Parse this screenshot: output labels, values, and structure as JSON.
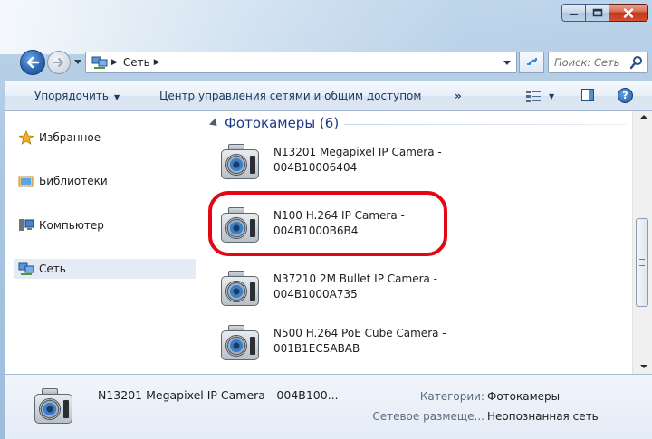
{
  "window": {
    "caption_buttons": [
      "minimize-icon",
      "maximize-icon",
      "close-icon"
    ],
    "accent_close": "#c1361c"
  },
  "nav": {
    "address_segments": [
      "Сеть"
    ],
    "search_placeholder": "Поиск: Сеть"
  },
  "command_bar": {
    "organize": "Упорядочить",
    "network_center": "Центр управления сетями и общим доступом",
    "overflow": "»"
  },
  "sidebar": {
    "items": [
      {
        "label": "Избранное",
        "icon": "star-icon"
      },
      {
        "label": "Библиотеки",
        "icon": "libraries-icon"
      },
      {
        "label": "Компьютер",
        "icon": "computer-icon"
      },
      {
        "label": "Сеть",
        "icon": "network-icon",
        "selected": true
      }
    ]
  },
  "group": {
    "title": "Фотокамеры (6)"
  },
  "items": [
    {
      "line1": "N13201 Megapixel IP Camera -",
      "line2": "004B10006404",
      "icon": "camera-icon"
    },
    {
      "line1": "N100 H.264 IP Camera -",
      "line2": "004B1000B6B4",
      "icon": "camera-icon",
      "highlighted": true
    },
    {
      "line1": "N37210 2M Bullet IP Camera -",
      "line2": "004B1000A735",
      "icon": "camera-icon"
    },
    {
      "line1": "N500 H.264 PoE Cube Camera -",
      "line2": "001B1EC5ABAB",
      "icon": "camera-icon"
    }
  ],
  "details": {
    "name": "N13201 Megapixel IP Camera - 004B100...",
    "category_label": "Категории:",
    "category_value": "Фотокамеры",
    "location_label": "Сетевое размеще...",
    "location_value": "Неопознанная сеть"
  },
  "colors": {
    "highlight_ring": "#e30613",
    "link_blue": "#1e3a8a"
  }
}
